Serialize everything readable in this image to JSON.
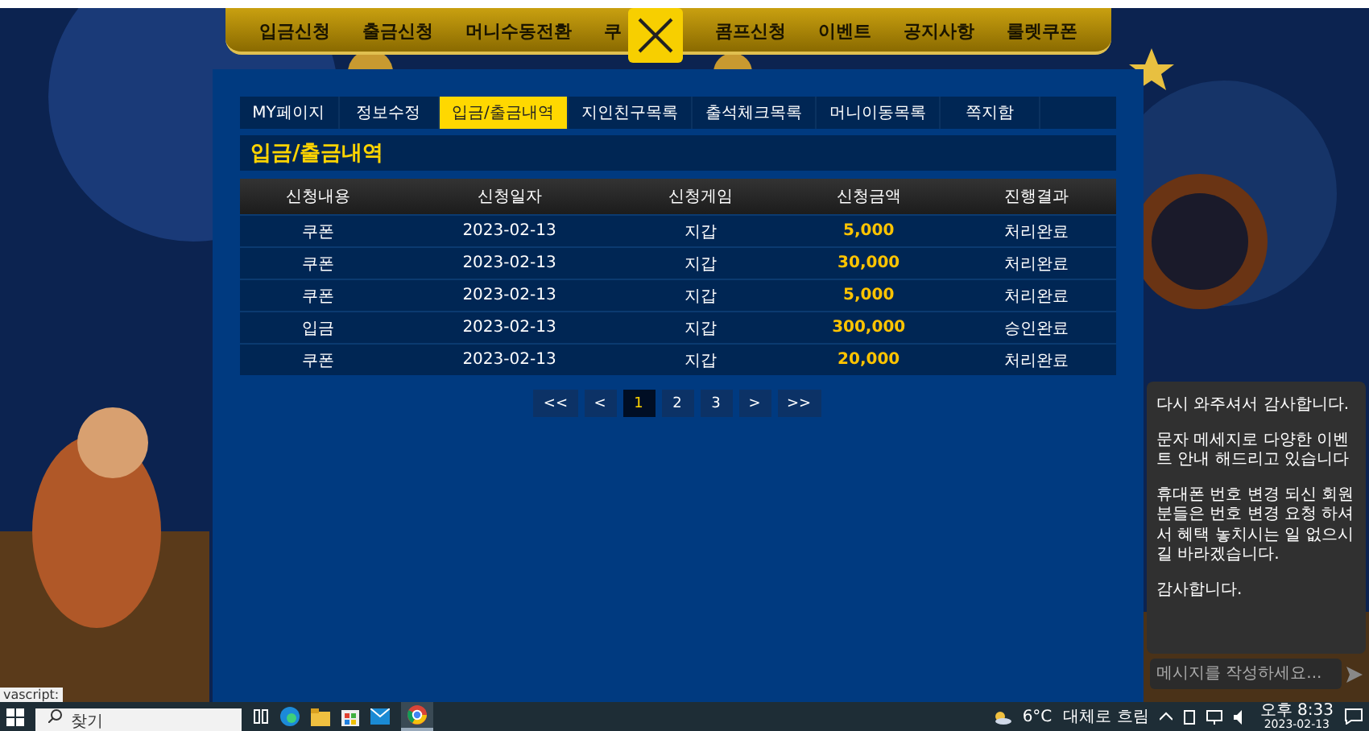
{
  "nav": {
    "items_left": [
      "입금신청",
      "출금신청",
      "머니수동전환",
      "쿠"
    ],
    "items_right": [
      "콤프신청",
      "이벤트",
      "공지사항",
      "룰렛쿠폰"
    ]
  },
  "tabs": [
    {
      "label": "MY페이지",
      "selected": false
    },
    {
      "label": "정보수정",
      "selected": false
    },
    {
      "label": "입금/출금내역",
      "selected": true
    },
    {
      "label": "지인친구목록",
      "selected": false
    },
    {
      "label": "출석체크목록",
      "selected": false
    },
    {
      "label": "머니이동목록",
      "selected": false
    },
    {
      "label": "쪽지함",
      "selected": false
    }
  ],
  "section_title": "입금/출금내역",
  "table": {
    "columns": [
      "신청내용",
      "신청일자",
      "신청게임",
      "신청금액",
      "진행결과"
    ],
    "rows": [
      {
        "type": "쿠폰",
        "date": "2023-02-13",
        "game": "지갑",
        "amount": "5,000",
        "status": "처리완료"
      },
      {
        "type": "쿠폰",
        "date": "2023-02-13",
        "game": "지갑",
        "amount": "30,000",
        "status": "처리완료"
      },
      {
        "type": "쿠폰",
        "date": "2023-02-13",
        "game": "지갑",
        "amount": "5,000",
        "status": "처리완료"
      },
      {
        "type": "입금",
        "date": "2023-02-13",
        "game": "지갑",
        "amount": "300,000",
        "status": "승인완료"
      },
      {
        "type": "쿠폰",
        "date": "2023-02-13",
        "game": "지갑",
        "amount": "20,000",
        "status": "처리완료"
      }
    ]
  },
  "pagination": [
    {
      "label": "<<",
      "selected": false
    },
    {
      "label": "<",
      "selected": false
    },
    {
      "label": "1",
      "selected": true
    },
    {
      "label": "2",
      "selected": false
    },
    {
      "label": "3",
      "selected": false
    },
    {
      "label": ">",
      "selected": false
    },
    {
      "label": ">>",
      "selected": false
    }
  ],
  "chat": {
    "messages": [
      "다시 와주셔서 감사합니다.",
      "문자 메세지로 다양한 이벤트 안내 해드리고 있습니다",
      "휴대폰 번호 변경 되신 회원 분들은 번호 변경 요청 하셔서 혜택 놓치시는 일 없으시길 바라겠습니다.",
      "감사합니다."
    ],
    "placeholder": "메시지를 작성하세요..."
  },
  "status_tooltip": "vascript:",
  "taskbar": {
    "search_placeholder": "찾기",
    "temperature": "6°C",
    "weather": "대체로 흐림",
    "time": "오후 8:33",
    "date": "2023-02-13"
  }
}
